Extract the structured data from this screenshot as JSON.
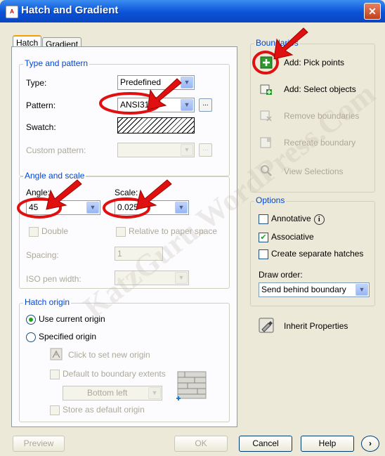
{
  "window": {
    "title": "Hatch and Gradient",
    "close": "✕"
  },
  "tabs": [
    {
      "label": "Hatch"
    },
    {
      "label": "Gradient"
    }
  ],
  "type_pattern": {
    "group": "Type and pattern",
    "type_label": "Type:",
    "type_value": "Predefined",
    "pattern_label": "Pattern:",
    "pattern_value": "ANSI31",
    "swatch_label": "Swatch:",
    "custom_label": "Custom pattern:"
  },
  "angle_scale": {
    "group": "Angle and scale",
    "angle_label": "Angle:",
    "angle_value": "45",
    "scale_label": "Scale:",
    "scale_value": "0.025",
    "double_label": "Double",
    "relative_label": "Relative to paper space",
    "spacing_label": "Spacing:",
    "spacing_value": "1",
    "iso_label": "ISO pen width:"
  },
  "hatch_origin": {
    "group": "Hatch origin",
    "use_current": "Use current origin",
    "specified": "Specified origin",
    "click_set": "Click to set new origin",
    "default_extents": "Default to boundary extents",
    "bottom_left": "Bottom left",
    "store_default": "Store as default origin"
  },
  "boundaries": {
    "group": "Boundaries",
    "pick_points": "Add: Pick points",
    "select_objects": "Add: Select objects",
    "remove": "Remove boundaries",
    "recreate": "Recreate boundary",
    "view": "View Selections"
  },
  "options": {
    "group": "Options",
    "annotative": "Annotative",
    "associative": "Associative",
    "separate": "Create separate hatches",
    "draw_order_label": "Draw order:",
    "draw_order_value": "Send behind boundary"
  },
  "inherit": "Inherit Properties",
  "footer": {
    "preview": "Preview",
    "ok": "OK",
    "cancel": "Cancel",
    "help": "Help",
    "more": "›"
  },
  "watermark": "KatzGuru.WordPress.Com",
  "colors": {
    "title_bar": "#0a52d8",
    "group_label": "#0046d5",
    "annotation_red": "#e01010"
  }
}
